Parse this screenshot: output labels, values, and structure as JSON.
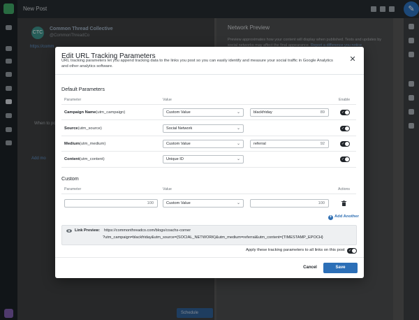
{
  "app": {
    "title": "New Post",
    "account": {
      "initials": "CTC",
      "name": "Common Thread Collective",
      "handle": "@CommonThreadCo"
    },
    "message_link": "https://comm",
    "when_label": "When to po",
    "add_more": "Add mo",
    "schedule_label": "Schedule",
    "preview": {
      "title": "Network Preview",
      "note": "Preview approximates how your content will display when published. Tests and updates by social networks may affect the final appearance.",
      "note_link": "Report a difference you notice"
    }
  },
  "modal": {
    "title": "Edit URL Tracking Parameters",
    "subtitle": "URL tracking parameters let you append tracking data to the links you post so you can easily identify and measure your social traffic in Google Analytics and other analytics software.",
    "close_icon": "close-icon",
    "default_section": {
      "title": "Default Parameters",
      "headers": {
        "parameter": "Parameter",
        "value": "Value",
        "enable": "Enable"
      },
      "rows": [
        {
          "label": "Campaign Name",
          "key": "(utm_campaign)",
          "select": "Custom Value",
          "input": "blackfriday",
          "count": "89",
          "enabled": true
        },
        {
          "label": "Source",
          "key": "(utm_source)",
          "select": "Social Network",
          "input": null,
          "count": null,
          "enabled": true
        },
        {
          "label": "Medium",
          "key": "(utm_medium)",
          "select": "Custom Value",
          "input": "referral",
          "count": "92",
          "enabled": true
        },
        {
          "label": "Content",
          "key": "(utm_content)",
          "select": "Unique ID",
          "input": null,
          "count": null,
          "enabled": true
        }
      ]
    },
    "custom_section": {
      "title": "Custom",
      "headers": {
        "parameter": "Parameter",
        "value": "Value",
        "actions": "Actions"
      },
      "row": {
        "param_count": "100",
        "select": "Custom Value",
        "value_count": "100"
      },
      "add_another": "Add Another"
    },
    "link_preview": {
      "label": "Link Preview:",
      "line1": "https://commonthreadco.com/blogs/coachs-corner",
      "line2": "?utm_campaign=blackfriday&utm_source={SOCIAL_NETWORK}&utm_medium=referral&utm_content={TIMESTAMP_EPOCH}"
    },
    "apply_all": {
      "label": "Apply these tracking parameters to all links on this post",
      "enabled": true
    },
    "cancel_label": "Cancel",
    "save_label": "Save"
  }
}
